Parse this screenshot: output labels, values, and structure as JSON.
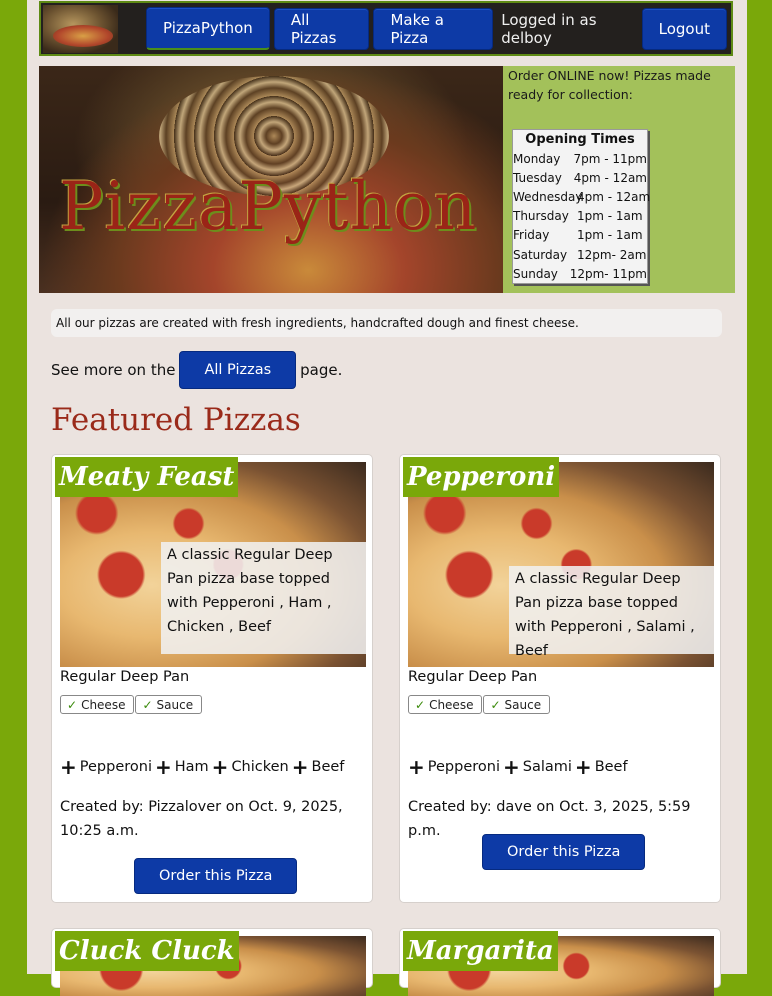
{
  "nav": {
    "brand_label": "PizzaPython",
    "all_pizzas_label": "All Pizzas",
    "make_pizza_label": "Make a Pizza",
    "status_text": "Logged in as delboy",
    "logout_label": "Logout"
  },
  "hero": {
    "title": "PizzaPython",
    "info_text": "Order ONLINE now! Pizzas made ready for collection:",
    "hours_title": "Opening Times",
    "hours": [
      {
        "day": "Monday",
        "time": "7pm  - 11pm"
      },
      {
        "day": "Tuesday",
        "time": "4pm  - 12am"
      },
      {
        "day": "Wednesday",
        "time": "4pm  - 12am"
      },
      {
        "day": "Thursday",
        "time": "1pm  - 1am"
      },
      {
        "day": "Friday",
        "time": "1pm  - 1am"
      },
      {
        "day": "Saturday",
        "time": "12pm- 2am"
      },
      {
        "day": "Sunday",
        "time": "12pm- 11pm"
      }
    ]
  },
  "intro": {
    "text": "All our pizzas are created with fresh ingredients, handcrafted dough and finest cheese."
  },
  "see_more": {
    "prefix": "See more on the",
    "button_label": "All Pizzas",
    "suffix": "page."
  },
  "featured": {
    "heading": "Featured Pizzas",
    "cards": [
      {
        "title": "Meaty Feast",
        "description": "A classic Regular Deep Pan pizza base topped with Pepperoni , Ham , Chicken , Beef",
        "base": "Regular Deep Pan",
        "chips": [
          "Cheese",
          "Sauce"
        ],
        "toppings": [
          "Pepperoni",
          "Ham",
          "Chicken",
          "Beef"
        ],
        "created": "Created by: Pizzalover on Oct. 9, 2025, 10:25 a.m.",
        "order_label": "Order this Pizza"
      },
      {
        "title": "Pepperoni",
        "description": "A classic Regular Deep Pan pizza base topped with Pepperoni , Salami , Beef",
        "base": "Regular Deep Pan",
        "chips": [
          "Cheese",
          "Sauce"
        ],
        "toppings": [
          "Pepperoni",
          "Salami",
          "Beef"
        ],
        "created": "Created by: dave on Oct. 3, 2025, 5:59 p.m.",
        "order_label": "Order this Pizza"
      },
      {
        "title": "Cluck Cluck"
      },
      {
        "title": "Margarita"
      }
    ]
  },
  "colors": {
    "page_bg": "#7aa80a",
    "content_bg": "#ebe3df",
    "button_blue": "#0d3aa6",
    "heading_red": "#9a2a1a",
    "title_badge_green": "#7aa80a"
  }
}
